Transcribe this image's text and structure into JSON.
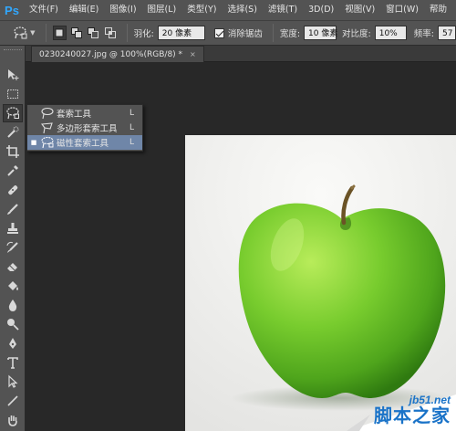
{
  "app": {
    "logo": "Ps"
  },
  "menubar": {
    "items": [
      "文件(F)",
      "编辑(E)",
      "图像(I)",
      "图层(L)",
      "类型(Y)",
      "选择(S)",
      "滤镜(T)",
      "3D(D)",
      "视图(V)",
      "窗口(W)",
      "帮助"
    ]
  },
  "options": {
    "feather_label": "羽化:",
    "feather_value": "20 像素",
    "antialias_label": "消除锯齿",
    "antialias_checked": true,
    "width_label": "宽度:",
    "width_value": "10 像素",
    "contrast_label": "对比度:",
    "contrast_value": "10%",
    "frequency_label": "频率:",
    "frequency_value": "57"
  },
  "document": {
    "tab_title": "0230240027.jpg @ 100%(RGB/8) *",
    "close_glyph": "×"
  },
  "flyout": {
    "items": [
      {
        "label": "套索工具",
        "key": "L",
        "icon": "lasso-icon",
        "selected": false,
        "bullet": ""
      },
      {
        "label": "多边形套索工具",
        "key": "L",
        "icon": "polygonal-lasso-icon",
        "selected": false,
        "bullet": ""
      },
      {
        "label": "磁性套索工具",
        "key": "L",
        "icon": "magnetic-lasso-icon",
        "selected": true,
        "bullet": "■"
      }
    ]
  },
  "tools": [
    "move-icon",
    "marquee-icon",
    "lasso-icon",
    "quick-select-icon",
    "crop-icon",
    "eyedropper-icon",
    "healing-brush-icon",
    "brush-icon",
    "clone-stamp-icon",
    "history-brush-icon",
    "eraser-icon",
    "paint-bucket-icon",
    "blur-icon",
    "dodge-icon",
    "pen-icon",
    "type-icon",
    "path-select-icon",
    "line-icon",
    "hand-icon"
  ],
  "watermark": {
    "domain": "jb51.net",
    "text": "脚本之家"
  },
  "colors": {
    "ui_panel": "#535353",
    "canvas_bg": "#282828",
    "selection": "#6f86a8",
    "ps_blue": "#31a8ff",
    "apple_green": "#6cc22a",
    "watermark_blue": "#1a73c8"
  }
}
